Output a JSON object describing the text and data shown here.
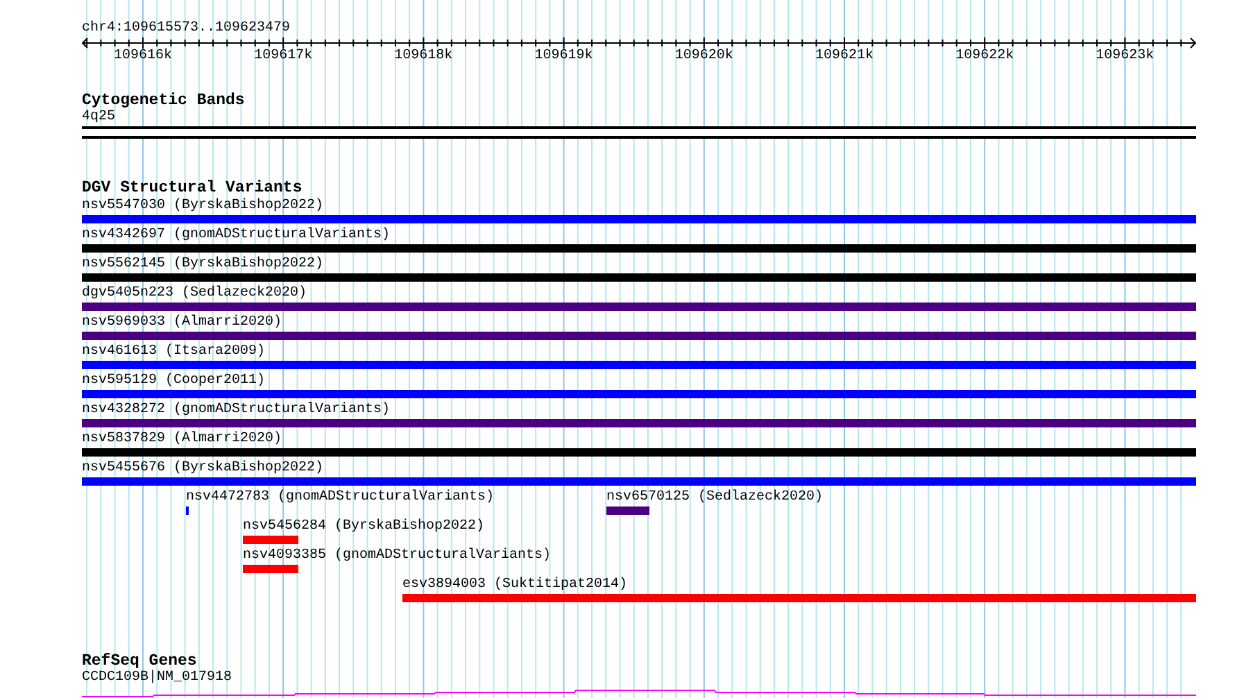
{
  "ruler": {
    "location": "chr4:109615573..109623479",
    "ticks": [
      "109616k",
      "109617k",
      "109618k",
      "109619k",
      "109620k",
      "109621k",
      "109622k",
      "109623k"
    ]
  },
  "tracks": [
    {
      "kind": "cytoband",
      "title": "Cytogenetic Bands",
      "band": "4q25"
    },
    {
      "kind": "variants",
      "title": "DGV Structural Variants",
      "features": [
        {
          "label": "nsv5547030 (ByrskaBishop2022)",
          "color": "#0000ff"
        },
        {
          "label": "nsv4342697 (gnomADStructuralVariants)",
          "color": "#000000"
        },
        {
          "label": "nsv5562145 (ByrskaBishop2022)",
          "color": "#000000"
        },
        {
          "label": "dgv5405n223 (Sedlazeck2020)",
          "color": "#4b0082"
        },
        {
          "label": "nsv5969033 (Almarri2020)",
          "color": "#4b0082"
        },
        {
          "label": "nsv461613 (Itsara2009)",
          "color": "#0000ff"
        },
        {
          "label": "nsv595129 (Cooper2011)",
          "color": "#0000ff"
        },
        {
          "label": "nsv4328272 (gnomADStructuralVariants)",
          "color": "#4b0082"
        },
        {
          "label": "nsv5837829 (Almarri2020)",
          "color": "#000000"
        },
        {
          "label": "nsv5455676 (ByrskaBishop2022)",
          "color": "#0000ff"
        },
        {
          "label": "nsv4472783 (gnomADStructuralVariants)",
          "color": "#0000ff"
        },
        {
          "label": "nsv6570125 (Sedlazeck2020)",
          "color": "#4b0082"
        },
        {
          "label": "nsv5456284 (ByrskaBishop2022)",
          "color": "#ff0000"
        },
        {
          "label": "nsv4093385 (gnomADStructuralVariants)",
          "color": "#ff0000"
        },
        {
          "label": "esv3894003 (Suktitipat2014)",
          "color": "#ff0000"
        }
      ]
    },
    {
      "kind": "genes",
      "title": "RefSeq Genes",
      "genes": [
        {
          "label": "CCDC109B|NM_017918",
          "color": "#ff00ff"
        }
      ]
    }
  ]
}
